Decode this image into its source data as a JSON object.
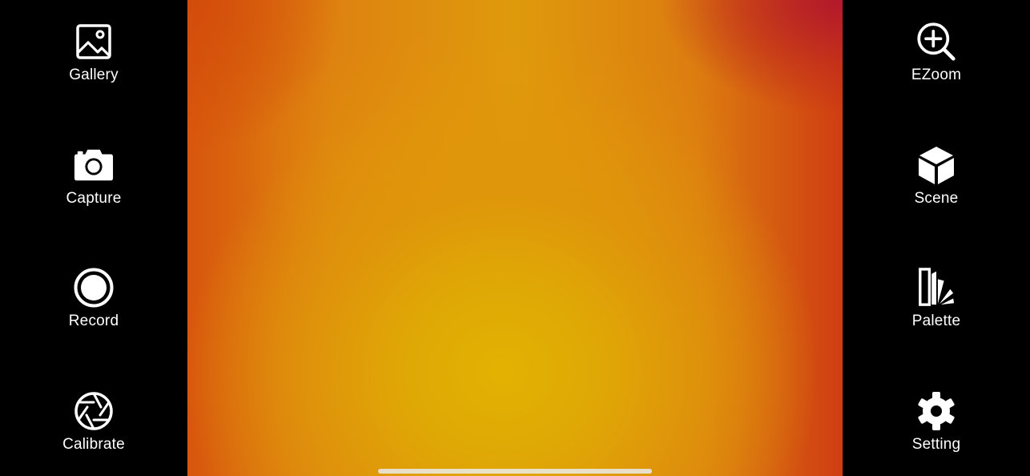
{
  "left_toolbar": {
    "items": [
      {
        "label": "Gallery",
        "icon": "gallery-icon"
      },
      {
        "label": "Capture",
        "icon": "camera-icon"
      },
      {
        "label": "Record",
        "icon": "record-icon"
      },
      {
        "label": "Calibrate",
        "icon": "aperture-icon"
      }
    ]
  },
  "right_toolbar": {
    "items": [
      {
        "label": "EZoom",
        "icon": "zoom-in-icon"
      },
      {
        "label": "Scene",
        "icon": "cube-icon"
      },
      {
        "label": "Palette",
        "icon": "palette-icon"
      },
      {
        "label": "Setting",
        "icon": "gear-icon"
      }
    ]
  },
  "colors": {
    "background": "#000000",
    "label": "#ffffff",
    "thermal_hot": "#e2b202",
    "thermal_warm": "#dc7c10",
    "thermal_edge": "#b2182c"
  }
}
